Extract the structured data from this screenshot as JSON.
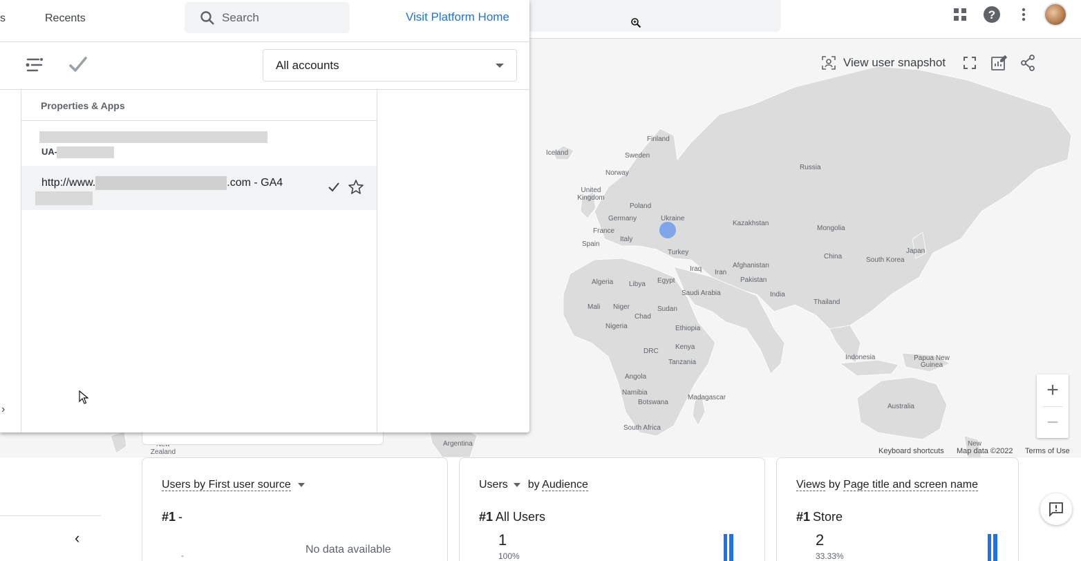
{
  "popup": {
    "tab_partial": "s",
    "tab_recents": "Recents",
    "search_placeholder": "Search",
    "visit_link": "Visit Platform Home",
    "account_select": "All accounts",
    "column_header": "Properties & Apps",
    "properties": [
      {
        "id_prefix": "UA-",
        "selected": false
      },
      {
        "name_prefix": "http://www.",
        "name_suffix": ".com - GA4",
        "selected": true
      }
    ],
    "icons": [
      "filter-lines-icon",
      "check-icon",
      "star-outline-icon",
      "chevron-right-icon"
    ]
  },
  "topbar": {
    "icons": [
      "apps-grid-icon",
      "help-icon",
      "more-vert-icon",
      "avatar"
    ]
  },
  "map": {
    "tools": {
      "snapshot_label": "View user snapshot"
    },
    "labels": {
      "iceland": "Iceland",
      "finland": "Finland",
      "sweden": "Sweden",
      "norway": "Norway",
      "uk": "United Kingdom",
      "poland": "Poland",
      "ukraine": "Ukraine",
      "germany": "Germany",
      "france": "France",
      "italy": "Italy",
      "spain": "Spain",
      "russia": "Russia",
      "kazakhstan": "Kazakhstan",
      "mongolia": "Mongolia",
      "turkey": "Turkey",
      "iraq": "Iraq",
      "iran": "Iran",
      "afghanistan": "Afghanistan",
      "pakistan": "Pakistan",
      "china": "China",
      "south_korea": "South Korea",
      "japan": "Japan",
      "india": "India",
      "thailand": "Thailand",
      "algeria": "Algeria",
      "libya": "Libya",
      "egypt": "Egypt",
      "saudi": "Saudi Arabia",
      "mali": "Mali",
      "niger": "Niger",
      "chad": "Chad",
      "sudan": "Sudan",
      "nigeria": "Nigeria",
      "ethiopia": "Ethiopia",
      "kenya": "Kenya",
      "drc": "DRC",
      "tanzania": "Tanzania",
      "angola": "Angola",
      "namibia": "Namibia",
      "botswana": "Botswana",
      "madagascar": "Madagascar",
      "south_africa": "South Africa",
      "indonesia": "Indonesia",
      "png": "Papua New Guinea",
      "australia": "Australia",
      "argentina": "Argentina",
      "new_zealand": "New Zealand",
      "new_partial": "New"
    },
    "footer": {
      "shortcuts": "Keyboard shortcuts",
      "map_data": "Map data ©2022",
      "terms": "Terms of Use"
    },
    "zoom_in": "+",
    "zoom_out": "−"
  },
  "cards": [
    {
      "title_a": "Users by First user source",
      "rank": "#1",
      "rank_value": "-",
      "small_dash": "-",
      "no_data": "No data available"
    },
    {
      "metric": "Users",
      "by": "by",
      "dimension": "Audience",
      "rank": "#1",
      "rank_value": "All Users",
      "number": "1",
      "percent": "100%"
    },
    {
      "metric": "Views",
      "by": "by",
      "dimension": "Page title and screen name",
      "rank": "#1",
      "rank_value": "Store",
      "number": "2",
      "percent": "33.33%"
    }
  ],
  "sidebar": {
    "collapse_icon": "chevron-left-icon"
  },
  "colors": {
    "accent": "#1a73e8",
    "map_land": "#dcdcdc",
    "map_water": "#f5f5f5",
    "marker": "#6d9eeb"
  }
}
